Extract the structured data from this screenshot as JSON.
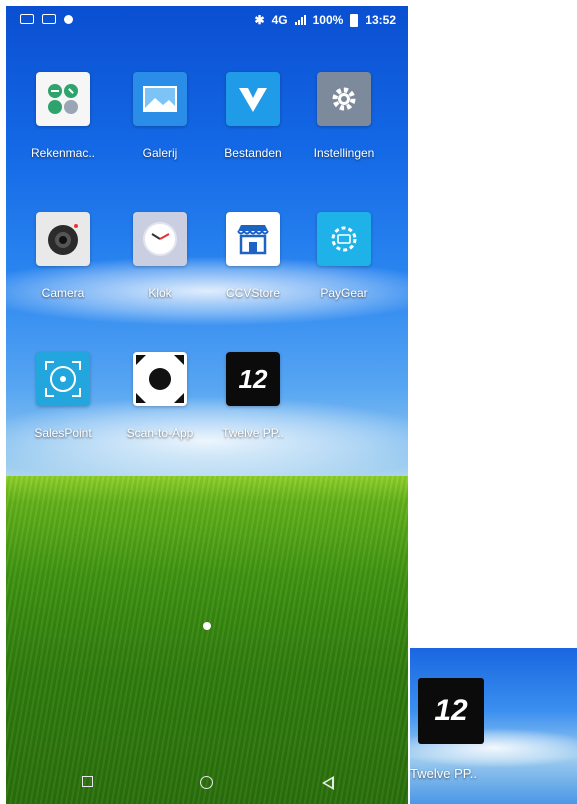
{
  "status_bar": {
    "network": "4G",
    "battery": "100%",
    "time": "13:52"
  },
  "apps": [
    {
      "label": "Rekenmac..",
      "icon": "calculator-icon"
    },
    {
      "label": "Galerij",
      "icon": "gallery-icon"
    },
    {
      "label": "Bestanden",
      "icon": "files-icon"
    },
    {
      "label": "Instellingen",
      "icon": "settings-gear-icon"
    },
    {
      "label": "Camera",
      "icon": "camera-icon"
    },
    {
      "label": "Klok",
      "icon": "clock-icon"
    },
    {
      "label": "CCVStore",
      "icon": "store-icon"
    },
    {
      "label": "PayGear",
      "icon": "paygear-icon"
    },
    {
      "label": "SalesPoint",
      "icon": "salespoint-icon"
    },
    {
      "label": "Scan-to-App",
      "icon": "scan-icon"
    },
    {
      "label": "Twelve PP..",
      "icon": "twelve-icon"
    }
  ],
  "twelve_logo_text": "12",
  "inset": {
    "label": "Twelve PP..",
    "logo_text": "12"
  },
  "colors": {
    "sky": "#1469e6",
    "grass": "#3f9412"
  }
}
